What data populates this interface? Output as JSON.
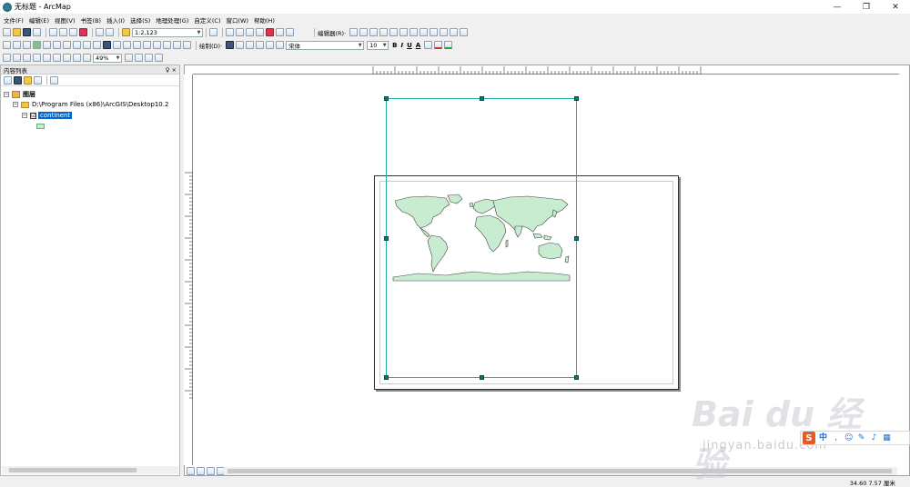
{
  "window": {
    "title": "无标题 - ArcMap"
  },
  "menu": [
    "文件(F)",
    "编辑(E)",
    "视图(V)",
    "书签(B)",
    "插入(I)",
    "选择(S)",
    "地理处理(G)",
    "自定义(C)",
    "窗口(W)",
    "帮助(H)"
  ],
  "toolbar": {
    "scale": "1:2,123",
    "editor_label": "编辑器(R)·",
    "draw_label": "绘制(D)·",
    "font_name": "宋体",
    "font_size": "10",
    "bold": "B",
    "italic": "I",
    "underline": "U",
    "font_color_label": "A",
    "zoom_percent": "49%"
  },
  "toc": {
    "title": "内容列表",
    "pin": "♀ ×",
    "root_label": "图层",
    "data_frame_path": "D:\\Program Files (x86)\\ArcGIS\\Desktop10.2",
    "layer_name": "continent",
    "layer_checked": "☑"
  },
  "status": {
    "coords": "34.60  7.57 厘米"
  },
  "watermark": {
    "logo": "Bai du 经验",
    "url": "jingyan.baidu.com"
  },
  "ime": {
    "logo": "S",
    "mode": "中"
  }
}
